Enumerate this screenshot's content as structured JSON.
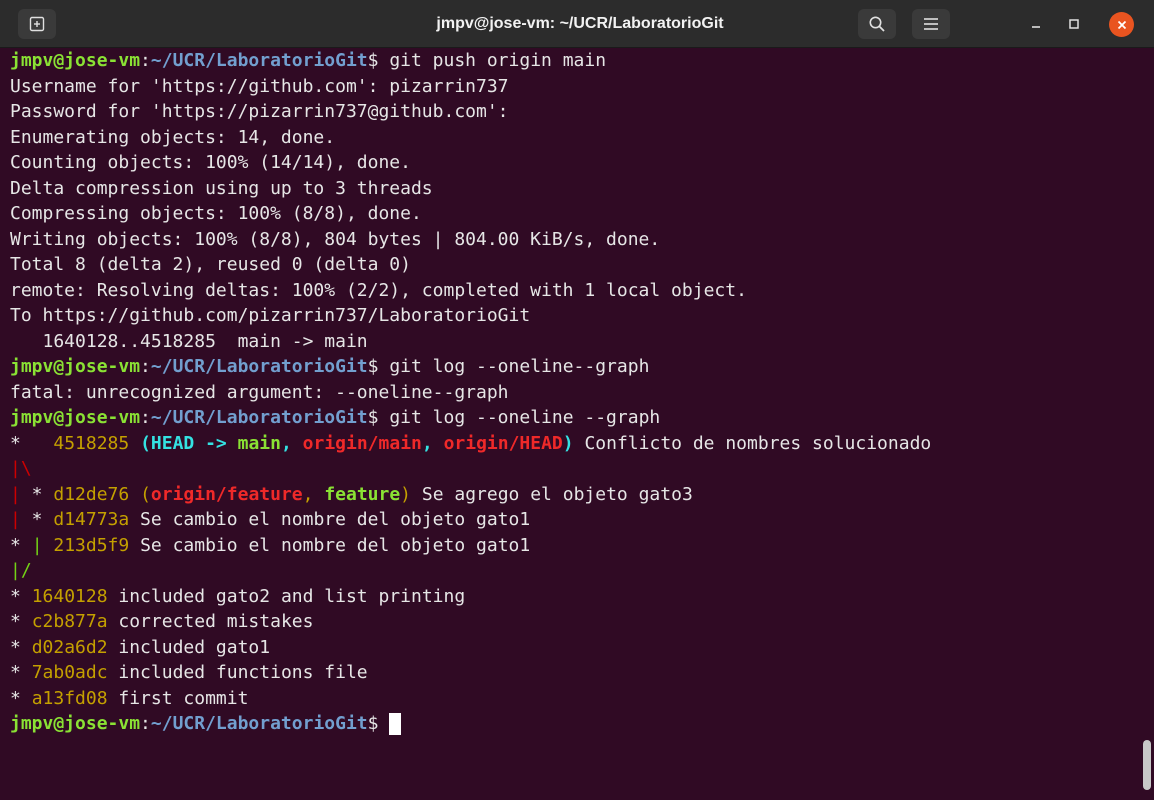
{
  "window": {
    "title": "jmpv@jose-vm: ~/UCR/LaboratorioGit"
  },
  "titlebar": {
    "icons": [
      "new-tab-icon",
      "search-icon",
      "hamburger-menu-icon",
      "minimize-icon",
      "maximize-icon",
      "close-icon"
    ]
  },
  "colors": {
    "background": "#300a24",
    "prompt_user": "#8ae234",
    "prompt_path": "#729fcf",
    "hash": "#c4a000",
    "head": "#34e2e2",
    "remote_branch": "#ef2929",
    "close_button": "#e95420"
  },
  "terminal": {
    "prompt_user": "jmpv@jose-vm",
    "prompt_path": "~/UCR/LaboratorioGit",
    "lines": [
      [
        [
          "p_user",
          "jmpv@jose-vm"
        ],
        [
          "t",
          ":"
        ],
        [
          "p_path",
          "~/UCR/LaboratorioGit"
        ],
        [
          "t",
          "$ git push origin main"
        ]
      ],
      [
        [
          "t",
          "Username for 'https://github.com': pizarrin737"
        ]
      ],
      [
        [
          "t",
          "Password for 'https://pizarrin737@github.com':"
        ]
      ],
      [
        [
          "t",
          "Enumerating objects: 14, done."
        ]
      ],
      [
        [
          "t",
          "Counting objects: 100% (14/14), done."
        ]
      ],
      [
        [
          "t",
          "Delta compression using up to 3 threads"
        ]
      ],
      [
        [
          "t",
          "Compressing objects: 100% (8/8), done."
        ]
      ],
      [
        [
          "t",
          "Writing objects: 100% (8/8), 804 bytes | 804.00 KiB/s, done."
        ]
      ],
      [
        [
          "t",
          "Total 8 (delta 2), reused 0 (delta 0)"
        ]
      ],
      [
        [
          "t",
          "remote: Resolving deltas: 100% (2/2), completed with 1 local object."
        ]
      ],
      [
        [
          "t",
          "To https://github.com/pizarrin737/LaboratorioGit"
        ]
      ],
      [
        [
          "t",
          "   1640128..4518285  main -> main"
        ]
      ],
      [
        [
          "p_user",
          "jmpv@jose-vm"
        ],
        [
          "t",
          ":"
        ],
        [
          "p_path",
          "~/UCR/LaboratorioGit"
        ],
        [
          "t",
          "$ git log --oneline--graph"
        ]
      ],
      [
        [
          "t",
          "fatal: unrecognized argument: --oneline--graph"
        ]
      ],
      [
        [
          "p_user",
          "jmpv@jose-vm"
        ],
        [
          "t",
          ":"
        ],
        [
          "p_path",
          "~/UCR/LaboratorioGit"
        ],
        [
          "t",
          "$ git log --oneline --graph"
        ]
      ],
      [
        [
          "t",
          "*   "
        ],
        [
          "hash",
          "4518285"
        ],
        [
          "t",
          " "
        ],
        [
          "head",
          "("
        ],
        [
          "head",
          "HEAD -> "
        ],
        [
          "local",
          "main"
        ],
        [
          "head",
          ", "
        ],
        [
          "remote",
          "origin/main"
        ],
        [
          "head",
          ", "
        ],
        [
          "remote",
          "origin/HEAD"
        ],
        [
          "head",
          ")"
        ],
        [
          "t",
          " Conflicto de nombres solucionado"
        ]
      ],
      [
        [
          "red",
          "|\\"
        ]
      ],
      [
        [
          "red",
          "|"
        ],
        [
          "t",
          " * "
        ],
        [
          "hash",
          "d12de76"
        ],
        [
          "t",
          " "
        ],
        [
          "hash",
          "("
        ],
        [
          "remote",
          "origin/feature"
        ],
        [
          "hash",
          ", "
        ],
        [
          "local",
          "feature"
        ],
        [
          "hash",
          ")"
        ],
        [
          "t",
          " Se agrego el objeto gato3"
        ]
      ],
      [
        [
          "red",
          "|"
        ],
        [
          "t",
          " * "
        ],
        [
          "hash",
          "d14773a"
        ],
        [
          "t",
          " Se cambio el nombre del objeto gato1"
        ]
      ],
      [
        [
          "t",
          "* "
        ],
        [
          "green",
          "|"
        ],
        [
          "t",
          " "
        ],
        [
          "hash",
          "213d5f9"
        ],
        [
          "t",
          " Se cambio el nombre del objeto gato1"
        ]
      ],
      [
        [
          "green",
          "|/"
        ]
      ],
      [
        [
          "t",
          "* "
        ],
        [
          "hash",
          "1640128"
        ],
        [
          "t",
          " included gato2 and list printing"
        ]
      ],
      [
        [
          "t",
          "* "
        ],
        [
          "hash",
          "c2b877a"
        ],
        [
          "t",
          " corrected mistakes"
        ]
      ],
      [
        [
          "t",
          "* "
        ],
        [
          "hash",
          "d02a6d2"
        ],
        [
          "t",
          " included gato1"
        ]
      ],
      [
        [
          "t",
          "* "
        ],
        [
          "hash",
          "7ab0adc"
        ],
        [
          "t",
          " included functions file"
        ]
      ],
      [
        [
          "t",
          "* "
        ],
        [
          "hash",
          "a13fd08"
        ],
        [
          "t",
          " first commit"
        ]
      ],
      [
        [
          "p_user",
          "jmpv@jose-vm"
        ],
        [
          "t",
          ":"
        ],
        [
          "p_path",
          "~/UCR/LaboratorioGit"
        ],
        [
          "t",
          "$ "
        ],
        [
          "cursor",
          ""
        ]
      ]
    ]
  }
}
